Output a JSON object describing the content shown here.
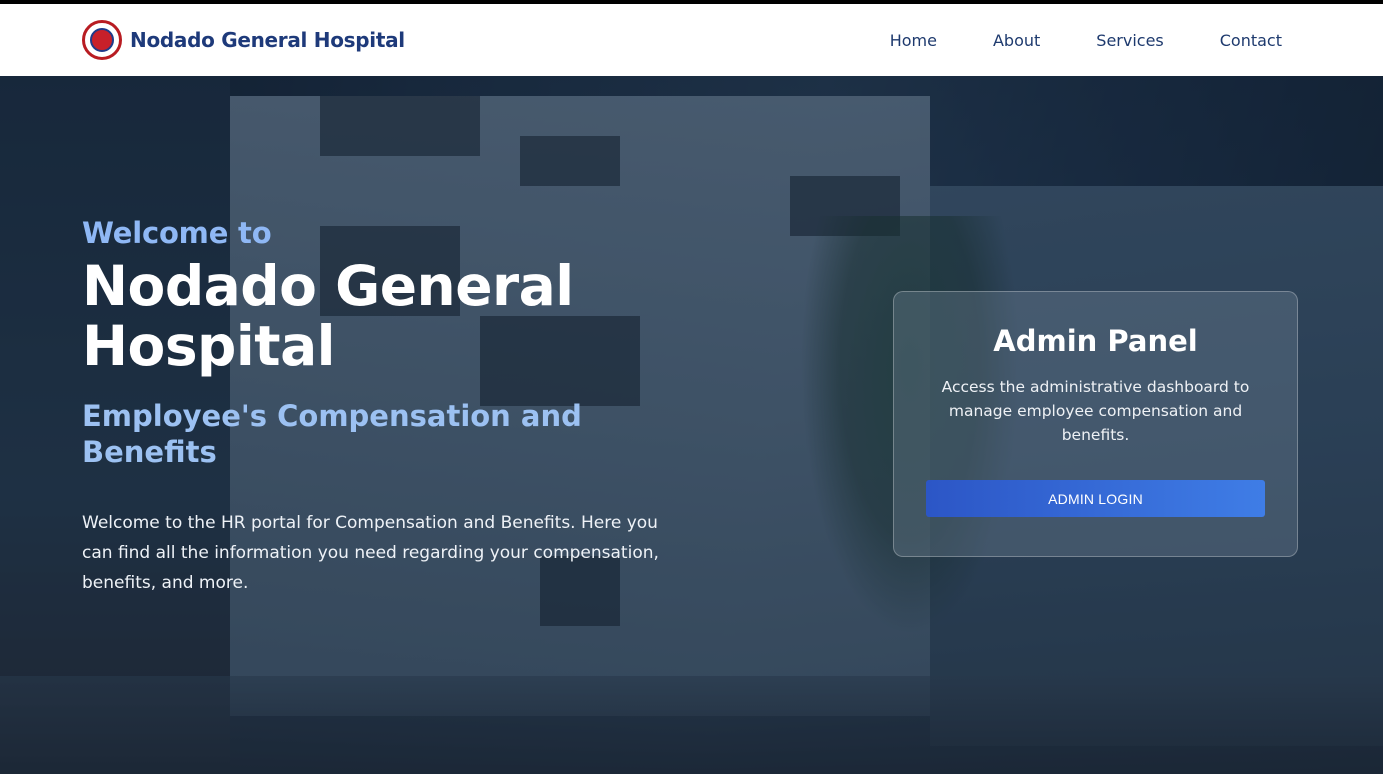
{
  "header": {
    "brand_name": "Nodado General Hospital",
    "logo_icon": "hospital-seal-logo",
    "nav": [
      {
        "label": "Home"
      },
      {
        "label": "About"
      },
      {
        "label": "Services"
      },
      {
        "label": "Contact"
      }
    ]
  },
  "hero": {
    "welcome": "Welcome to",
    "title": "Nodado General Hospital",
    "subtitle": "Employee's Compensation and Benefits",
    "intro": "Welcome to the HR portal for Compensation and Benefits. Here you can find all the information you need regarding your compensation, benefits, and more."
  },
  "admin_panel": {
    "title": "Admin Panel",
    "description": "Access the administrative dashboard to manage employee compensation and benefits.",
    "button_label": "ADMIN LOGIN"
  },
  "colors": {
    "brand": "#1e3a7a",
    "accent_light_blue": "#8fb8f5",
    "button_gradient_start": "#2c56c6",
    "button_gradient_end": "#3f7de6"
  }
}
